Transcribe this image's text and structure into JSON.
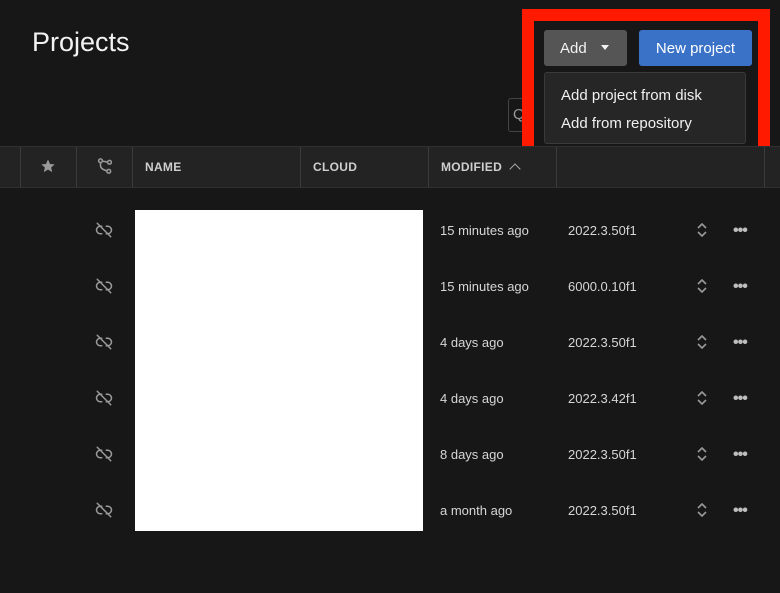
{
  "page": {
    "title": "Projects"
  },
  "toolbar": {
    "add_label": "Add",
    "new_project_label": "New project",
    "add_menu": [
      "Add project from disk",
      "Add from repository"
    ]
  },
  "search": {
    "partial_glyph": "Q"
  },
  "table": {
    "columns": {
      "name": "NAME",
      "cloud": "CLOUD",
      "modified": "MODIFIED"
    },
    "rows": [
      {
        "modified": "15 minutes ago",
        "version": "2022.3.50f1"
      },
      {
        "modified": "15 minutes ago",
        "version": "6000.0.10f1"
      },
      {
        "modified": "4 days ago",
        "version": "2022.3.50f1"
      },
      {
        "modified": "4 days ago",
        "version": "2022.3.42f1"
      },
      {
        "modified": "8 days ago",
        "version": "2022.3.50f1"
      },
      {
        "modified": "a month ago",
        "version": "2022.3.50f1"
      }
    ]
  },
  "icons": {
    "favorite": "star-icon",
    "connection": "branch-icon",
    "cloud_status": "unlinked-icon",
    "version_select": "chevron-updown-icon",
    "row_menu": "more-icon",
    "sort": "chevron-up-icon"
  },
  "colors": {
    "background": "#171717",
    "primary": "#3a72c7",
    "annotation": "#ff1a00"
  }
}
